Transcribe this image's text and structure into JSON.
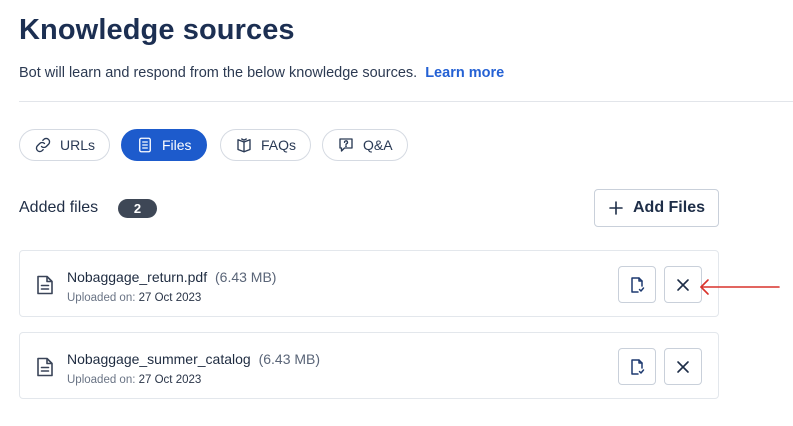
{
  "header": {
    "title": "Knowledge sources",
    "subtitle": "Bot will learn and respond from the below knowledge sources.",
    "learn_more": "Learn more"
  },
  "tabs": [
    {
      "label": "URLs",
      "icon": "link-icon",
      "active": false
    },
    {
      "label": "Files",
      "icon": "document-icon",
      "active": true
    },
    {
      "label": "FAQs",
      "icon": "book-icon",
      "active": false
    },
    {
      "label": "Q&A",
      "icon": "chat-question-icon",
      "active": false
    }
  ],
  "files_section": {
    "label": "Added files",
    "count": "2",
    "add_button": "Add Files"
  },
  "files": [
    {
      "name": "Nobaggage_return.pdf",
      "size": "(6.43 MB)",
      "uploaded_label": "Uploaded on:",
      "uploaded_date": "27 Oct 2023"
    },
    {
      "name": "Nobaggage_summer_catalog",
      "size": "(6.43 MB)",
      "uploaded_label": "Uploaded on:",
      "uploaded_date": "27 Oct 2023"
    }
  ],
  "colors": {
    "accent": "#1d5bcc",
    "title": "#1c2f52",
    "link": "#2461d4",
    "badge": "#3e4756",
    "annotation_arrow": "#d9322b"
  }
}
